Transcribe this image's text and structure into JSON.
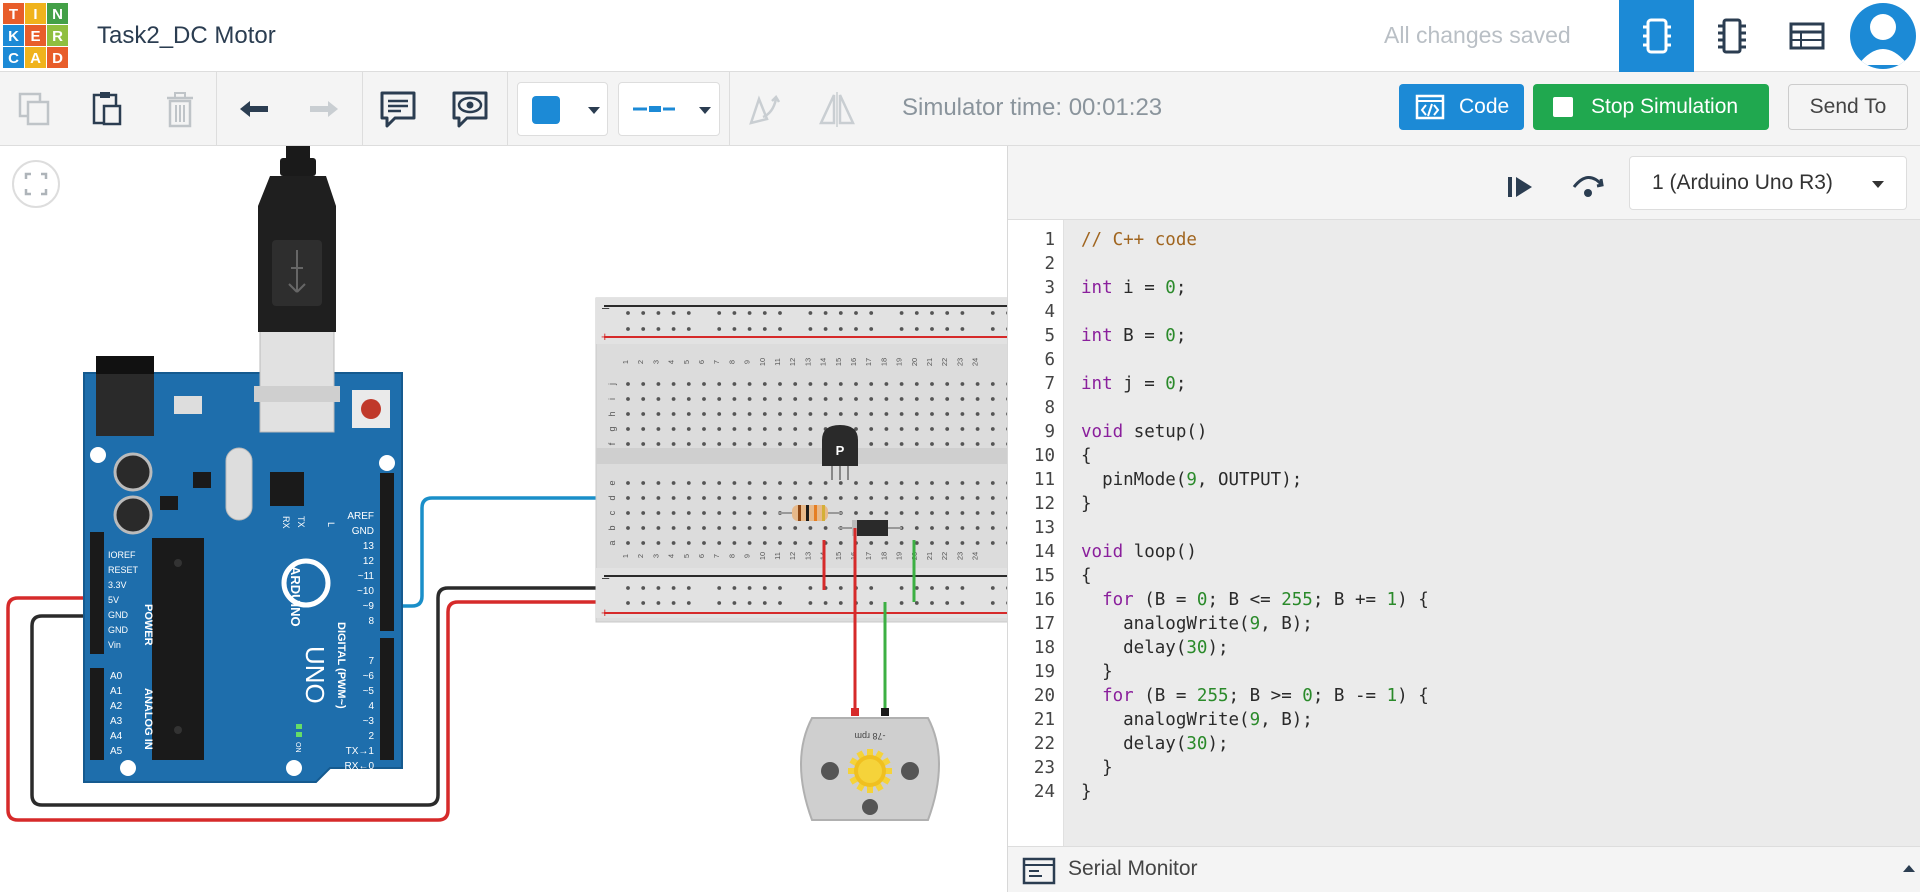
{
  "app": {
    "logo_letters": [
      "T",
      "I",
      "N",
      "K",
      "E",
      "R",
      "C",
      "A",
      "D"
    ],
    "logo_colors": [
      "#e85d2a",
      "#f0b31c",
      "#43a047",
      "#1c8ad6",
      "#e85d2a",
      "#8fbf3f",
      "#1c8ad6",
      "#f0b31c",
      "#e85d2a"
    ],
    "project_title": "Task2_DC Motor",
    "save_status": "All changes saved"
  },
  "header": {
    "views": [
      {
        "name": "circuit-view",
        "icon": "breadboard-icon",
        "active": true
      },
      {
        "name": "schematic-view",
        "icon": "chip-icon",
        "active": false
      },
      {
        "name": "component-list-view",
        "icon": "table-icon",
        "active": false
      }
    ],
    "avatar_icon": "user-icon"
  },
  "toolbar": {
    "simulator_time": "Simulator time: 00:01:23",
    "code_label": "Code",
    "stop_label": "Stop Simulation",
    "send_label": "Send To",
    "fill_color": "#1c8ad6",
    "accent": "#1c8ad6",
    "stop_color": "#20a84f"
  },
  "breadboard": {
    "column_numbers": [
      "1",
      "2",
      "3",
      "4",
      "5",
      "6",
      "7",
      "8",
      "9",
      "10",
      "11",
      "12",
      "13",
      "14",
      "15",
      "16",
      "17",
      "18",
      "19",
      "20",
      "21",
      "22",
      "23",
      "24"
    ],
    "row_letters_top": [
      "j",
      "i",
      "h",
      "g",
      "f"
    ],
    "row_letters_bottom": [
      "e",
      "d",
      "c",
      "b",
      "a"
    ],
    "rail_minus": "–",
    "rail_plus": "+"
  },
  "components": {
    "transistor_label": "P",
    "motor_label": "-78 rpm",
    "arduino_brand": "ARDUINO",
    "arduino_model": "UNO",
    "power_label": "POWER",
    "analog_label": "ANALOG IN",
    "digital_label": "DIGITAL (PWM~)",
    "power_pins": [
      "IOREF",
      "RESET",
      "3.3V",
      "5V",
      "GND",
      "GND",
      "Vin"
    ],
    "analog_pins": [
      "A0",
      "A1",
      "A2",
      "A3",
      "A4",
      "A5"
    ],
    "digital_pins": [
      "AREF",
      "GND",
      "13",
      "12",
      "~11",
      "~10",
      "~9",
      "8",
      "7",
      "~6",
      "~5",
      "4",
      "~3",
      "2",
      "TX→1",
      "RX←0"
    ],
    "led_labels": [
      "L",
      "TX",
      "RX"
    ],
    "on_label": "ON"
  },
  "code_panel": {
    "board": "1 (Arduino Uno R3)",
    "line_numbers": [
      "1",
      "2",
      "3",
      "4",
      "5",
      "6",
      "7",
      "8",
      "9",
      "10",
      "11",
      "12",
      "13",
      "14",
      "15",
      "16",
      "17",
      "18",
      "19",
      "20",
      "21",
      "22",
      "23",
      "24"
    ],
    "serial_monitor_label": "Serial Monitor"
  },
  "code": {
    "l1": "// C++ code",
    "l3_kw": "int",
    "l3_mid": " i = ",
    "l3_num": "0",
    "l3_end": ";",
    "l5_kw": "int",
    "l5_mid": " B = ",
    "l5_num": "0",
    "l5_end": ";",
    "l7_kw": "int",
    "l7_mid": " j = ",
    "l7_num": "0",
    "l7_end": ";",
    "l9_kw": "void",
    "l9_rest": " setup()",
    "l10": "{",
    "l11_a": "  pinMode(",
    "l11_num": "9",
    "l11_b": ", OUTPUT);",
    "l12": "}",
    "l14_kw": "void",
    "l14_rest": " loop()",
    "l15": "{",
    "l16_ind": "  ",
    "l16_kw": "for",
    "l16_a": " (B = ",
    "l16_n1": "0",
    "l16_b": "; B <= ",
    "l16_n2": "255",
    "l16_c": "; B += ",
    "l16_n3": "1",
    "l16_d": ") {",
    "l17_a": "    analogWrite(",
    "l17_num": "9",
    "l17_b": ", B);",
    "l18_a": "    delay(",
    "l18_num": "30",
    "l18_b": ");",
    "l19": "  }",
    "l20_ind": "  ",
    "l20_kw": "for",
    "l20_a": " (B = ",
    "l20_n1": "255",
    "l20_b": "; B >= ",
    "l20_n2": "0",
    "l20_c": "; B -= ",
    "l20_n3": "1",
    "l20_d": ") {",
    "l21_a": "    analogWrite(",
    "l21_num": "9",
    "l21_b": ", B);",
    "l22_a": "    delay(",
    "l22_num": "30",
    "l22_b": ");",
    "l23": "  }",
    "l24": "}"
  }
}
